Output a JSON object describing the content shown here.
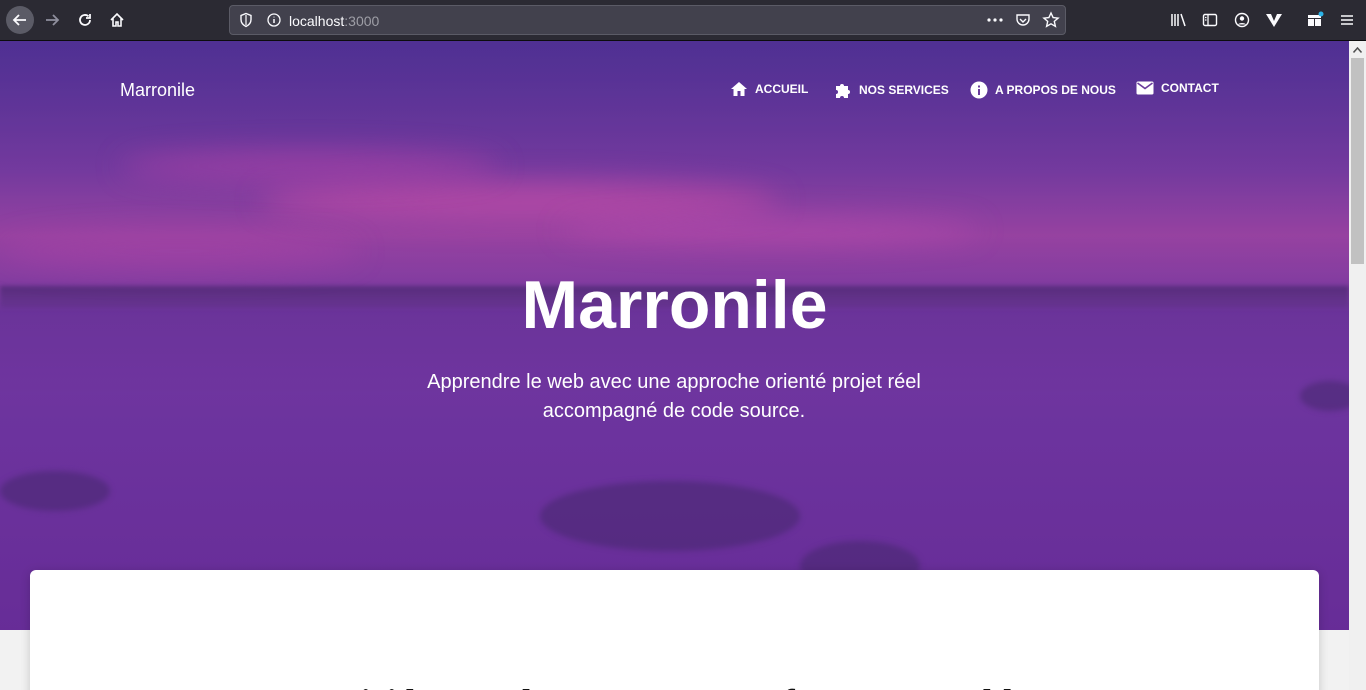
{
  "browser": {
    "url_host": "localhost",
    "url_port": ":3000"
  },
  "site": {
    "brand": "Marronile",
    "nav": [
      {
        "label": "ACCUEIL",
        "icon": "home-icon"
      },
      {
        "label": "NOS SERVICES",
        "icon": "puzzle-icon"
      },
      {
        "label": "A PROPOS DE NOUS",
        "icon": "info-icon"
      },
      {
        "label": "CONTACT",
        "icon": "mail-icon"
      }
    ],
    "hero": {
      "title": "Marronile",
      "subtitle": "Apprendre le web avec une approche orienté projet réel accompagné de code source."
    },
    "card": {
      "heading": "Voici les cas d'usage que nous ferons ensemble"
    }
  },
  "colors": {
    "hero_purple": "#6a3c9c",
    "browser_bg": "#2b2a33"
  }
}
